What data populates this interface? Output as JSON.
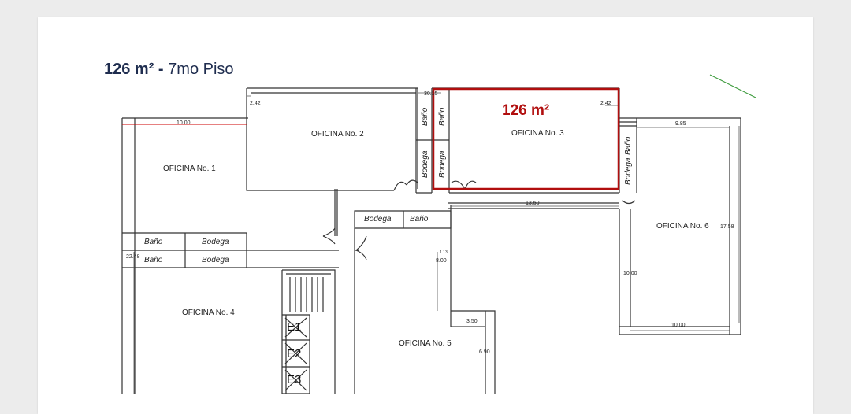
{
  "heading": {
    "area": "126 m²",
    "separator": " - ",
    "floor": "7mo Piso"
  },
  "highlight": {
    "area_label": "126 m²",
    "color": "#b10e0e"
  },
  "offices": [
    "OFICINA No. 1",
    "OFICINA No. 2",
    "OFICINA No. 3",
    "OFICINA No. 4",
    "OFICINA No. 5",
    "OFICINA No. 6"
  ],
  "rooms": {
    "bano": "Baño",
    "bodega": "Bodega"
  },
  "elevators": [
    "E1",
    "E2",
    "E3"
  ],
  "dimensions": {
    "d_2_42_left": "2.42",
    "d_30_15": "30.15",
    "d_2_42_right": "2.42",
    "d_10_00_top": "10.00",
    "d_9_85": "9.85",
    "d_13_50": "13.50",
    "d_17_58": "17.58",
    "d_22_48": "22.48",
    "d_1_13": "1.13",
    "d_8_00": "8.00",
    "d_10_00_mid": "10.00",
    "d_3_50": "3.50",
    "d_10_00_bottom": "10.00",
    "d_6_90": "6.90"
  }
}
